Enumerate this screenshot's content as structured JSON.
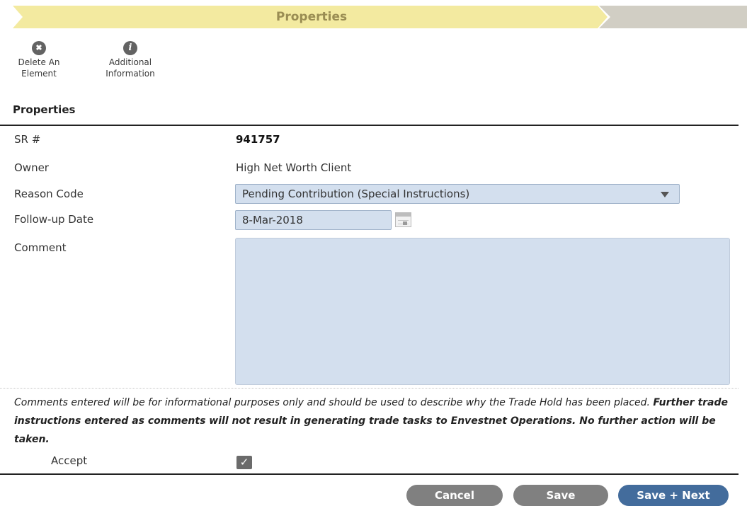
{
  "stepbar": {
    "active_label": "Properties"
  },
  "toolbar": {
    "delete": {
      "line1": "Delete An",
      "line2": "Element",
      "icon": "close-circle-icon",
      "glyph": "✖"
    },
    "info": {
      "line1": "Additional",
      "line2": "Information",
      "icon": "info-circle-icon",
      "glyph": "i"
    }
  },
  "section": {
    "title": "Properties"
  },
  "fields": {
    "sr": {
      "label": "SR #",
      "value": "941757"
    },
    "owner": {
      "label": "Owner",
      "value": "High Net Worth Client"
    },
    "reason": {
      "label": "Reason Code",
      "value": "Pending Contribution (Special Instructions)"
    },
    "followup": {
      "label": "Follow-up Date",
      "value": "8-Mar-2018"
    },
    "comment": {
      "label": "Comment",
      "value": ""
    }
  },
  "notice": {
    "normal": "Comments entered will be for informational purposes only and should be used to describe why the Trade Hold has been placed. ",
    "bold": "Further trade instructions entered as comments will not result in generating trade tasks to Envestnet Operations. No further action will be taken."
  },
  "accept": {
    "label": "Accept",
    "checked": true,
    "glyph": "✓"
  },
  "buttons": {
    "cancel": "Cancel",
    "save": "Save",
    "save_next": "Save + Next"
  },
  "colors": {
    "accent": "#436c9c",
    "field_bg": "#d3dfee",
    "step_active": "#f3eaa0",
    "step_inactive": "#d1cec4"
  }
}
